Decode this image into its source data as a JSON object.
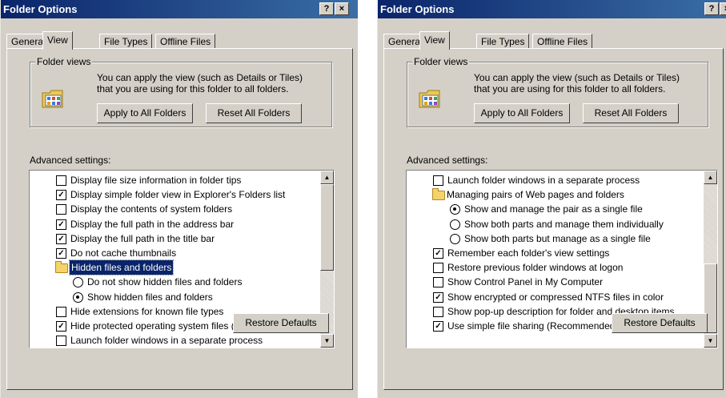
{
  "windows": [
    {
      "title": "Folder Options",
      "help_label": "?",
      "close_label": "×",
      "tabs": [
        "General",
        "View",
        "File Types",
        "Offline Files"
      ],
      "folder_views": {
        "label": "Folder views",
        "description": "You can apply the view (such as Details or Tiles) that you are using for this folder to all folders.",
        "apply_button": "Apply to All Folders",
        "reset_button": "Reset All Folders"
      },
      "advanced_label": "Advanced settings:",
      "items": [
        {
          "type": "checkbox",
          "checked": false,
          "indent": 1,
          "label": "Display file size information in folder tips"
        },
        {
          "type": "checkbox",
          "checked": true,
          "indent": 1,
          "label": "Display simple folder view in Explorer's Folders list"
        },
        {
          "type": "checkbox",
          "checked": false,
          "indent": 1,
          "label": "Display the contents of system folders"
        },
        {
          "type": "checkbox",
          "checked": true,
          "indent": 1,
          "label": "Display the full path in the address bar"
        },
        {
          "type": "checkbox",
          "checked": true,
          "indent": 1,
          "label": "Display the full path in the title bar"
        },
        {
          "type": "checkbox",
          "checked": true,
          "indent": 1,
          "label": "Do not cache thumbnails"
        },
        {
          "type": "folder",
          "indent": 1,
          "label": "Hidden files and folders",
          "selected": true
        },
        {
          "type": "radio",
          "checked": false,
          "indent": 2,
          "label": "Do not show hidden files and folders"
        },
        {
          "type": "radio",
          "checked": true,
          "indent": 2,
          "label": "Show hidden files and folders"
        },
        {
          "type": "checkbox",
          "checked": false,
          "indent": 1,
          "label": "Hide extensions for known file types"
        },
        {
          "type": "checkbox",
          "checked": true,
          "indent": 1,
          "label": "Hide protected operating system files (Recommended)"
        },
        {
          "type": "checkbox",
          "checked": false,
          "indent": 1,
          "label": "Launch folder windows in a separate process"
        }
      ],
      "restore_button": "Restore Defaults"
    },
    {
      "title": "Folder Options",
      "help_label": "?",
      "close_label": "×",
      "tabs": [
        "General",
        "View",
        "File Types",
        "Offline Files"
      ],
      "folder_views": {
        "label": "Folder views",
        "description": "You can apply the view (such as Details or Tiles) that you are using for this folder to all folders.",
        "apply_button": "Apply to All Folders",
        "reset_button": "Reset All Folders"
      },
      "advanced_label": "Advanced settings:",
      "items": [
        {
          "type": "checkbox",
          "checked": false,
          "indent": 1,
          "label": "Launch folder windows in a separate process"
        },
        {
          "type": "folder",
          "indent": 1,
          "label": "Managing pairs of Web pages and folders",
          "selected": false
        },
        {
          "type": "radio",
          "checked": true,
          "indent": 2,
          "label": "Show and manage the pair as a single file"
        },
        {
          "type": "radio",
          "checked": false,
          "indent": 2,
          "label": "Show both parts and manage them individually"
        },
        {
          "type": "radio",
          "checked": false,
          "indent": 2,
          "label": "Show both parts but manage as a single file"
        },
        {
          "type": "checkbox",
          "checked": true,
          "indent": 1,
          "label": "Remember each folder's view settings"
        },
        {
          "type": "checkbox",
          "checked": false,
          "indent": 1,
          "label": "Restore previous folder windows at logon"
        },
        {
          "type": "checkbox",
          "checked": false,
          "indent": 1,
          "label": "Show Control Panel in My Computer"
        },
        {
          "type": "checkbox",
          "checked": true,
          "indent": 1,
          "label": "Show encrypted or compressed NTFS files in color"
        },
        {
          "type": "checkbox",
          "checked": false,
          "indent": 1,
          "label": "Show pop-up description for folder and desktop items"
        },
        {
          "type": "checkbox",
          "checked": true,
          "indent": 1,
          "label": "Use simple file sharing (Recommended)"
        }
      ],
      "restore_button": "Restore Defaults"
    }
  ]
}
